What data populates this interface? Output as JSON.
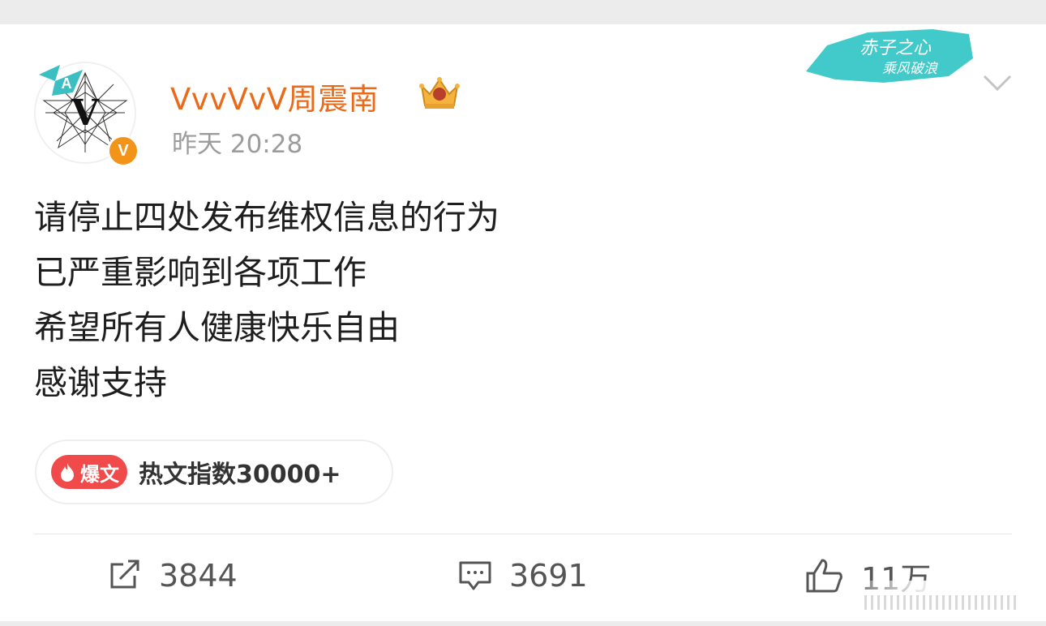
{
  "post": {
    "username": "VvvVvV周震南",
    "timestamp": "昨天 20:28",
    "verified_badge": "V",
    "avatar_letter": "V",
    "avatar_deco_letter": "A",
    "lines": [
      "请停止四处发布维权信息的行为",
      "已严重影响到各项工作",
      "希望所有人健康快乐自由",
      "感谢支持"
    ],
    "hot_tag": "爆文",
    "hot_index": "热文指数30000+"
  },
  "actions": {
    "repost_count": "3844",
    "comment_count": "3691",
    "like_count": "11万"
  },
  "topic_banner": {
    "line1": "赤子之心",
    "line2": "乘风破浪"
  },
  "colors": {
    "username": "#e86a1a",
    "verified": "#f29418",
    "hot_tag": "#f04a4a",
    "banner": "#2ec4c4"
  },
  "icons": [
    "repost-icon",
    "comment-icon",
    "like-icon",
    "chevron-down-icon",
    "crown-icon",
    "hot-fire-icon"
  ]
}
